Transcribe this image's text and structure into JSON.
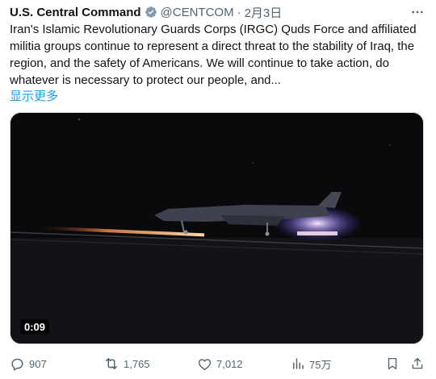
{
  "tweet": {
    "author_name": "U.S. Central Command",
    "handle": "@CENTCOM",
    "separator": "·",
    "date": "2月3日",
    "more_icon": "more-icon",
    "text": "Iran's Islamic Revolutionary Guards Corps (IRGC) Quds Force and affiliated militia groups continue to represent a direct threat to the stability of Iraq, the region, and the safety of Americans. We will continue to take action, do whatever is necessary to protect our people, and...",
    "show_more": "显示更多",
    "video_duration": "0:09"
  },
  "actions": {
    "reply_count": "907",
    "retweet_count": "1,765",
    "like_count": "7,012",
    "view_count": "75万"
  },
  "colors": {
    "link": "#1d9bf0",
    "secondary": "#536471",
    "verified_badge": "#829aab"
  }
}
